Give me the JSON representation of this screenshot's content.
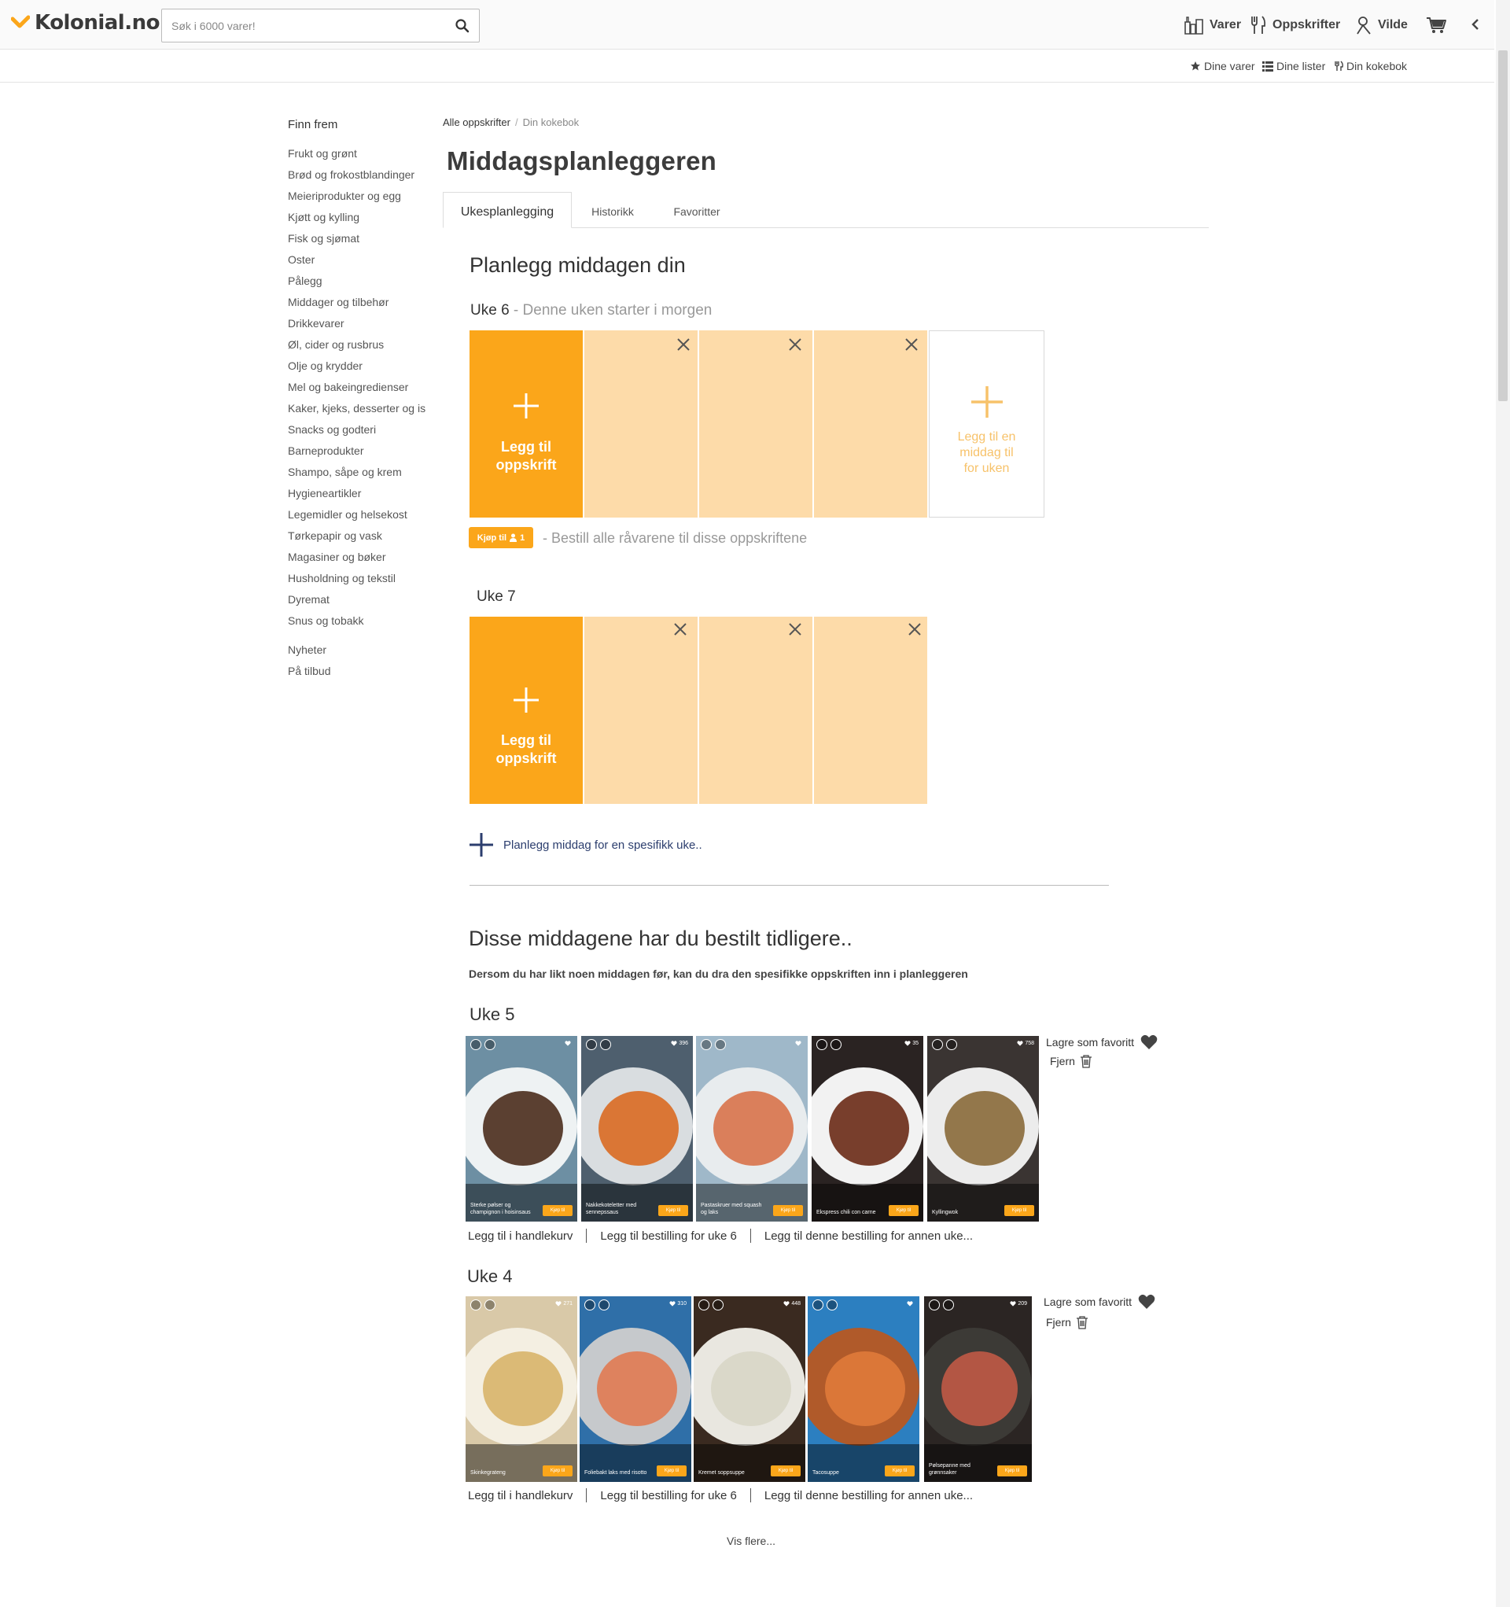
{
  "header": {
    "logo_text": "Kolonial.no",
    "search_placeholder": "Søk i 6000 varer!",
    "nav": [
      "Varer",
      "Oppskrifter",
      "Vilde"
    ],
    "sublinks": [
      "Dine varer",
      "Dine lister",
      "Din kokebok"
    ]
  },
  "sidebar": {
    "title": "Finn frem",
    "categories": [
      "Frukt og grønt",
      "Brød og frokostblandinger",
      "Meieriprodukter og egg",
      "Kjøtt og kylling",
      "Fisk og sjømat",
      "Oster",
      "Pålegg",
      "Middager og tilbehør",
      "Drikkevarer",
      "Øl, cider og rusbrus",
      "Olje og krydder",
      "Mel og bakeingredienser",
      "Kaker, kjeks, desserter og is",
      "Snacks og godteri",
      "Barneprodukter",
      "Shampo, såpe og krem",
      "Hygieneartikler",
      "Legemidler og helsekost",
      "Tørkepapir og vask",
      "Magasiner og bøker",
      "Husholdning og tekstil",
      "Dyremat",
      "Snus og tobakk"
    ],
    "extra": [
      "Nyheter",
      "På tilbud"
    ]
  },
  "breadcrumb": {
    "root": "Alle oppskrifter",
    "current": "Din kokebok"
  },
  "page_title": "Middagsplanleggeren",
  "tabs": [
    "Ukesplanlegging",
    "Historikk",
    "Favoritter"
  ],
  "planner": {
    "heading": "Planlegg middagen din",
    "weeks": [
      {
        "label": "Uke 6",
        "sub": "- Denne uken starter i morgen"
      },
      {
        "label": "Uke 7",
        "sub": ""
      }
    ],
    "add_recipe_line1": "Legg til",
    "add_recipe_line2": "oppskrift",
    "add_dinner_lines": [
      "Legg til en",
      "middag til",
      "for uken"
    ],
    "buy_label": "Kjøp til",
    "buy_count": "1",
    "buy_text": "- Bestill alle råvarene til disse oppskriftene",
    "plan_specific": "Planlegg middag for en spesifikk uke.."
  },
  "history": {
    "heading": "Disse middagene har du bestilt tidligere..",
    "description": "Dersom du har likt noen middagen før, kan du dra den spesifikke oppskriften inn i planleggeren",
    "fav_label": "Lagre som favoritt",
    "remove_label": "Fjern",
    "actions": [
      "Legg til i handlekurv",
      "Legg til bestilling for uke 6",
      "Legg til denne bestilling for annen uke..."
    ],
    "buy_small": "Kjøp til",
    "weeks": [
      {
        "label": "Uke 5",
        "recipes": [
          {
            "name": "Sterke pølser og champignon i hoisinsaus",
            "likes": "",
            "bg": "#6d8fa3",
            "plate": "#eef2f3",
            "food": "#4a2c1c"
          },
          {
            "name": "Nakkekoteletter med sennepssaus",
            "likes": "396",
            "bg": "#4e5f6e",
            "plate": "#d9dde0",
            "food": "#d96a22"
          },
          {
            "name": "Pastaskruer med squash og laks",
            "likes": "",
            "bg": "#9fb8c9",
            "plate": "#e8ecee",
            "food": "#d8734a"
          },
          {
            "name": "Ekspress chili con carne",
            "likes": "35",
            "bg": "#2a2322",
            "plate": "#f2f2f2",
            "food": "#6a2a16"
          },
          {
            "name": "Kyllingwok",
            "likes": "758",
            "bg": "#3a3432",
            "plate": "#ececec",
            "food": "#8a6a3a"
          }
        ]
      },
      {
        "label": "Uke 4",
        "recipes": [
          {
            "name": "Skinkegrateng",
            "likes": "271",
            "bg": "#d9c9a8",
            "plate": "#f4efe2",
            "food": "#d8b46a"
          },
          {
            "name": "Foliebakt laks med risotto",
            "likes": "310",
            "bg": "#2f6fa8",
            "plate": "#c6c9cc",
            "food": "#e07a52"
          },
          {
            "name": "Kremet soppsuppe",
            "likes": "448",
            "bg": "#3a2a20",
            "plate": "#e9e7e0",
            "food": "#d8d6c6"
          },
          {
            "name": "Tacosuppe",
            "likes": "",
            "bg": "#2c7fc0",
            "plate": "#b05a2a",
            "food": "#e07a3a"
          },
          {
            "name": "Pølsepanne med grønnsaker",
            "likes": "209",
            "bg": "#2b2523",
            "plate": "#3c3a36",
            "food": "#c05a46"
          }
        ]
      }
    ],
    "more": "Vis flere..."
  },
  "colors": {
    "accent": "#fba61a",
    "slot": "#fddba9",
    "add_week_text": "#f7c26a",
    "link_blue": "#2c3e6e"
  }
}
